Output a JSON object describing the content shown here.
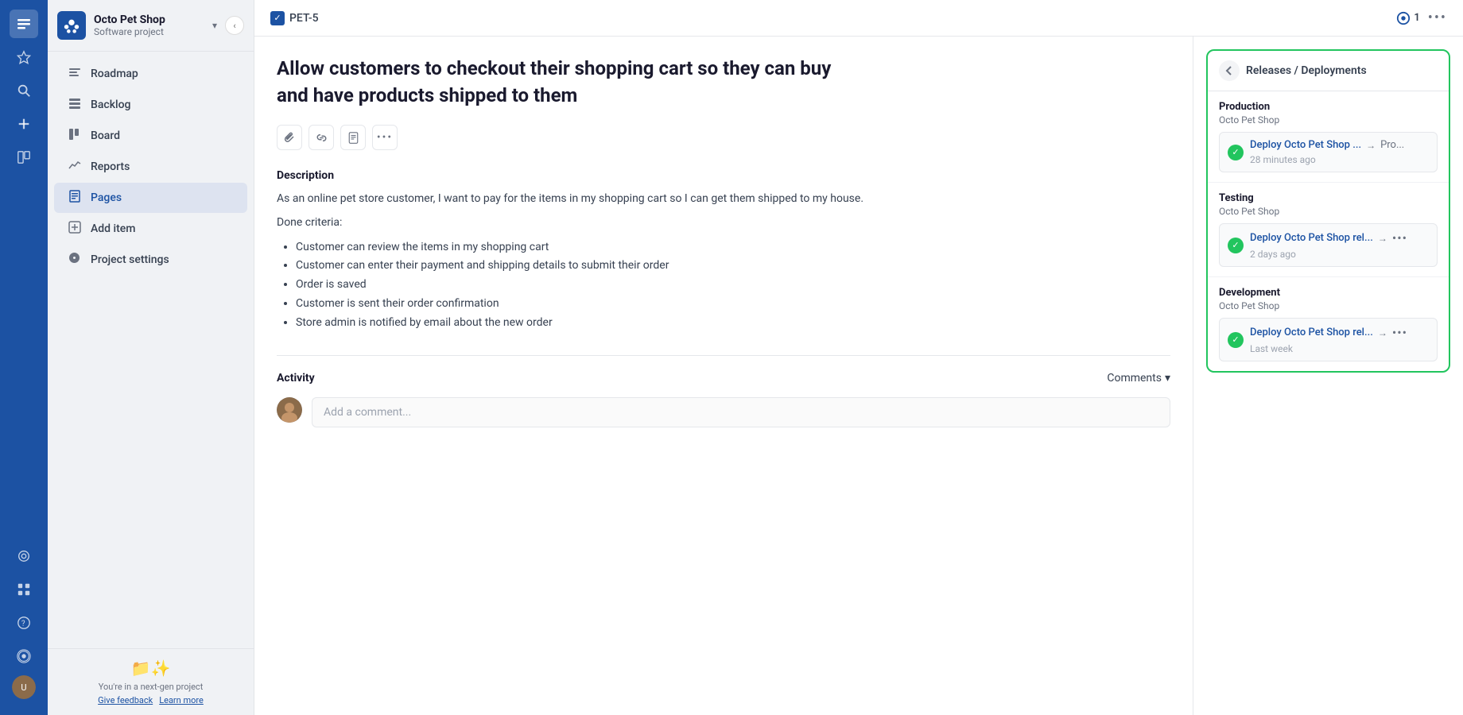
{
  "iconBar": {
    "icons": [
      {
        "name": "layers-icon",
        "symbol": "≋",
        "active": true
      },
      {
        "name": "star-icon",
        "symbol": "☆",
        "active": false
      },
      {
        "name": "search-icon",
        "symbol": "🔍",
        "active": false
      },
      {
        "name": "plus-icon",
        "symbol": "+",
        "active": false
      },
      {
        "name": "board-icon",
        "symbol": "⊞",
        "active": false
      },
      {
        "name": "flag-icon",
        "symbol": "⚑",
        "active": false
      },
      {
        "name": "grid-icon",
        "symbol": "⠿",
        "active": false
      },
      {
        "name": "help-icon",
        "symbol": "?",
        "active": false
      },
      {
        "name": "settings-icon",
        "symbol": "⚙",
        "active": false
      }
    ],
    "avatarInitial": "U"
  },
  "sidebar": {
    "projectName": "Octo Pet Shop",
    "projectType": "Software project",
    "collapseLabel": "‹",
    "nav": [
      {
        "name": "roadmap",
        "label": "Roadmap",
        "icon": "≡",
        "active": false
      },
      {
        "name": "backlog",
        "label": "Backlog",
        "icon": "☰",
        "active": false
      },
      {
        "name": "board",
        "label": "Board",
        "icon": "▦",
        "active": false
      },
      {
        "name": "reports",
        "label": "Reports",
        "icon": "📈",
        "active": false
      },
      {
        "name": "pages",
        "label": "Pages",
        "icon": "📄",
        "active": true
      },
      {
        "name": "add-item",
        "label": "Add item",
        "icon": "＋",
        "active": false
      },
      {
        "name": "project-settings",
        "label": "Project settings",
        "icon": "⚙",
        "active": false
      }
    ],
    "footer": {
      "emoji": "📁✨",
      "text": "You're in a next-gen project",
      "links": [
        "Give feedback",
        "Learn more"
      ]
    }
  },
  "header": {
    "issueId": "PET-5",
    "watchLabel": "1",
    "moreLabel": "•••"
  },
  "issue": {
    "title": "Allow customers to checkout their shopping cart so they can buy and have products shipped to them",
    "toolbar": [
      {
        "name": "attach-icon",
        "symbol": "📎"
      },
      {
        "name": "link-icon",
        "symbol": "🔗"
      },
      {
        "name": "page-icon",
        "symbol": "📋"
      },
      {
        "name": "more-icon",
        "symbol": "•••"
      }
    ],
    "descriptionLabel": "Description",
    "descriptionText": "As an online pet store customer, I want to pay for the items in my shopping cart so I can get them shipped to my house.",
    "doneCriteria": "Done criteria:",
    "bullets": [
      "Customer can review the items in my shopping cart",
      "Customer can enter their payment and shipping details to submit their order",
      "Order is saved",
      "Customer is sent their order confirmation",
      "Store admin is notified by email about the new order"
    ],
    "activityLabel": "Activity",
    "commentsLabel": "Comments",
    "commentPlaceholder": "Add a comment..."
  },
  "releasesPanel": {
    "backLabel": "←",
    "title": "Releases / Deployments",
    "environments": [
      {
        "name": "Production",
        "project": "Octo Pet Shop",
        "deployName": "Deploy Octo Pet Shop ...",
        "deployDest": "Pro...",
        "time": "28 minutes ago"
      },
      {
        "name": "Testing",
        "project": "Octo Pet Shop",
        "deployName": "Deploy Octo Pet Shop rel...",
        "deployDest": "...",
        "time": "2 days ago"
      },
      {
        "name": "Development",
        "project": "Octo Pet Shop",
        "deployName": "Deploy Octo Pet Shop rel...",
        "deployDest": "...",
        "time": "Last week"
      }
    ]
  }
}
